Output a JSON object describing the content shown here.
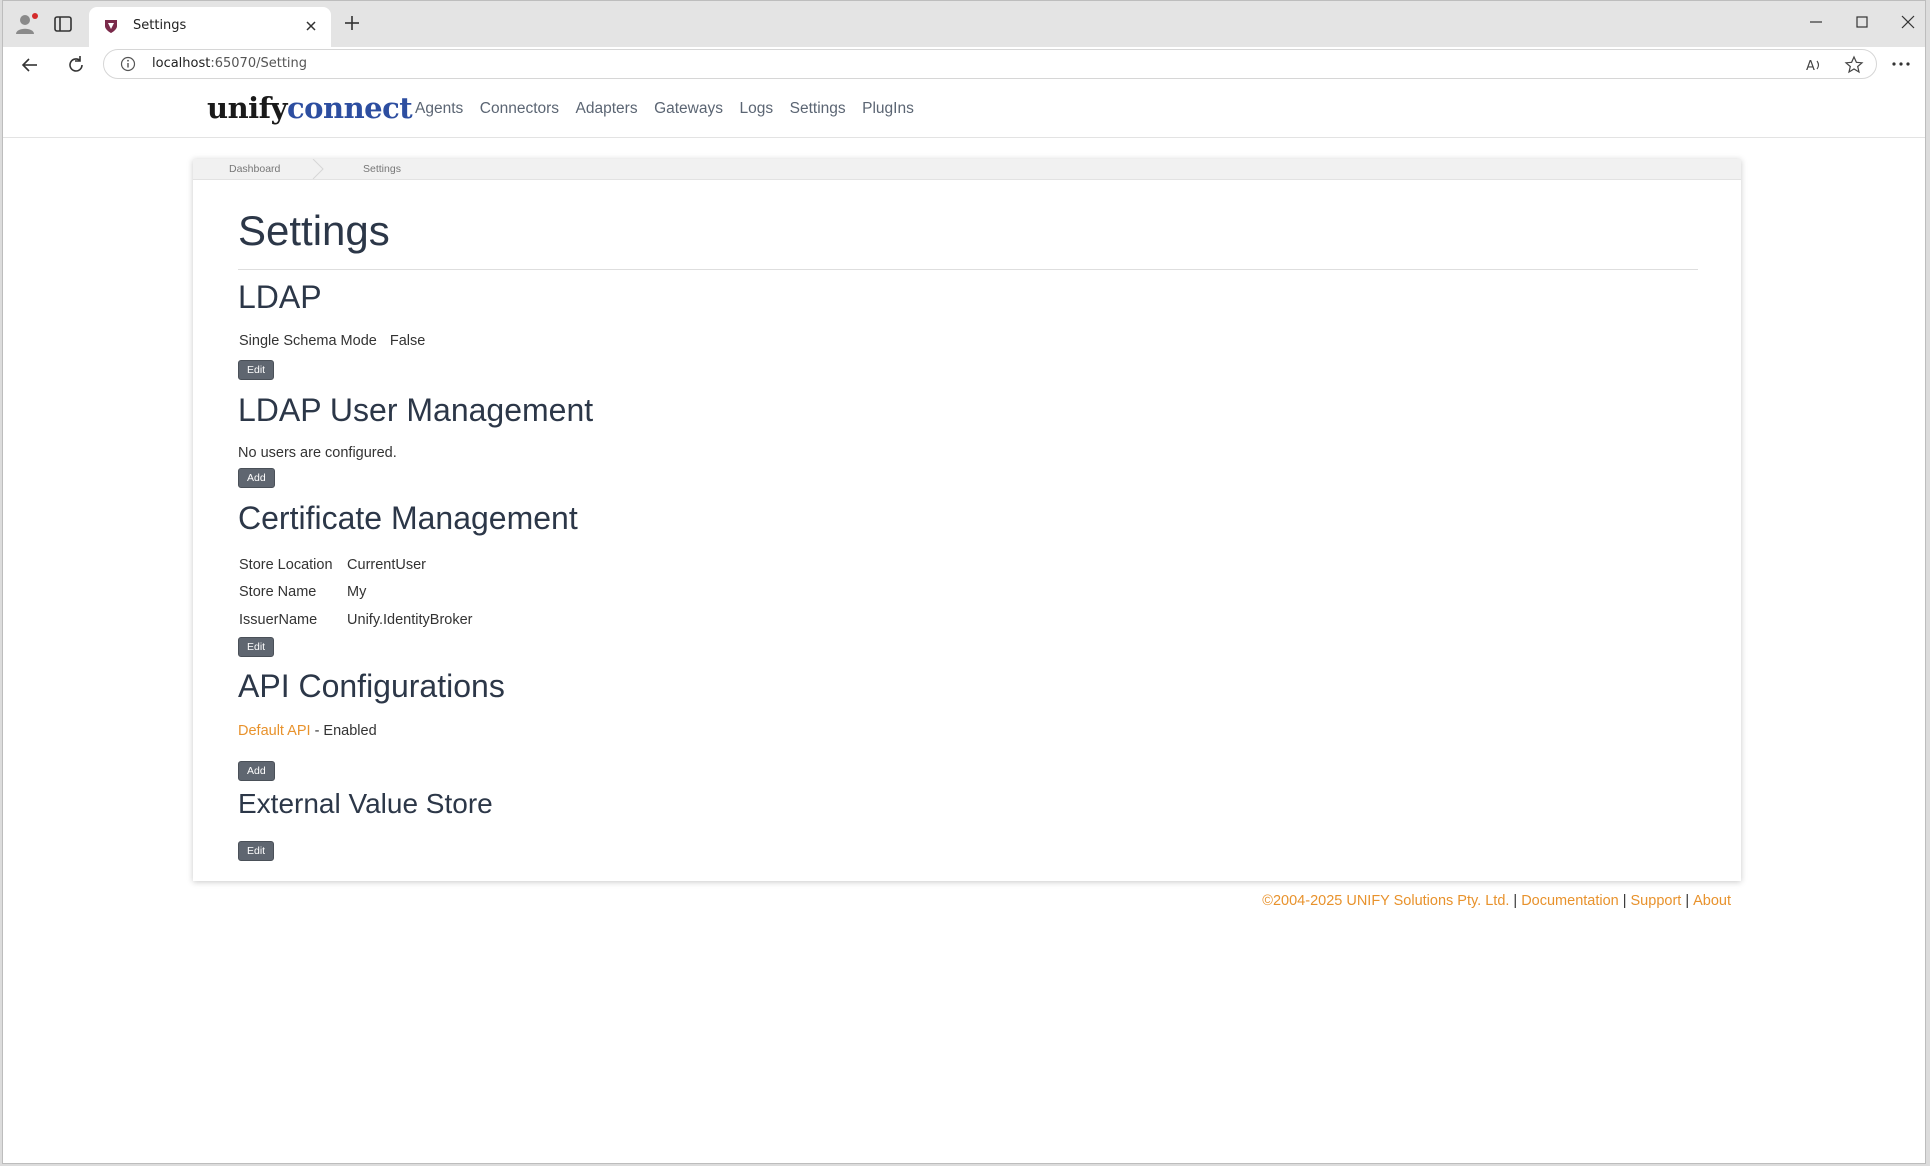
{
  "browser": {
    "tab_title": "Settings",
    "url_host": "localhost",
    "url_rest": ":65070/Setting"
  },
  "brand": {
    "part1": "unify",
    "part2": "connect"
  },
  "nav": {
    "items": [
      "Agents",
      "Connectors",
      "Adapters",
      "Gateways",
      "Logs",
      "Settings",
      "PlugIns"
    ]
  },
  "breadcrumb": {
    "items": [
      "Dashboard",
      "Settings"
    ]
  },
  "page_title": "Settings",
  "ldap": {
    "heading": "LDAP",
    "single_schema_label": "Single Schema Mode",
    "single_schema_value": "False",
    "edit_label": "Edit"
  },
  "ldap_users": {
    "heading": "LDAP User Management",
    "empty_text": "No users are configured.",
    "add_label": "Add"
  },
  "certificate": {
    "heading": "Certificate Management",
    "rows": [
      {
        "label": "Store Location",
        "value": "CurrentUser"
      },
      {
        "label": "Store Name",
        "value": "My"
      },
      {
        "label": "IssuerName",
        "value": "Unify.IdentityBroker"
      }
    ],
    "edit_label": "Edit"
  },
  "api": {
    "heading": "API Configurations",
    "item_link": "Default API",
    "item_status": " - Enabled",
    "add_label": "Add"
  },
  "external_store": {
    "heading": "External Value Store",
    "edit_label": "Edit"
  },
  "footer": {
    "copyright": "©2004-2025 UNIFY Solutions Pty. Ltd.",
    "links": [
      "Documentation",
      "Support",
      "About"
    ]
  },
  "colors": {
    "accent": "#e8922c",
    "brand_blue": "#2d4ea0",
    "button": "#5f6670"
  }
}
